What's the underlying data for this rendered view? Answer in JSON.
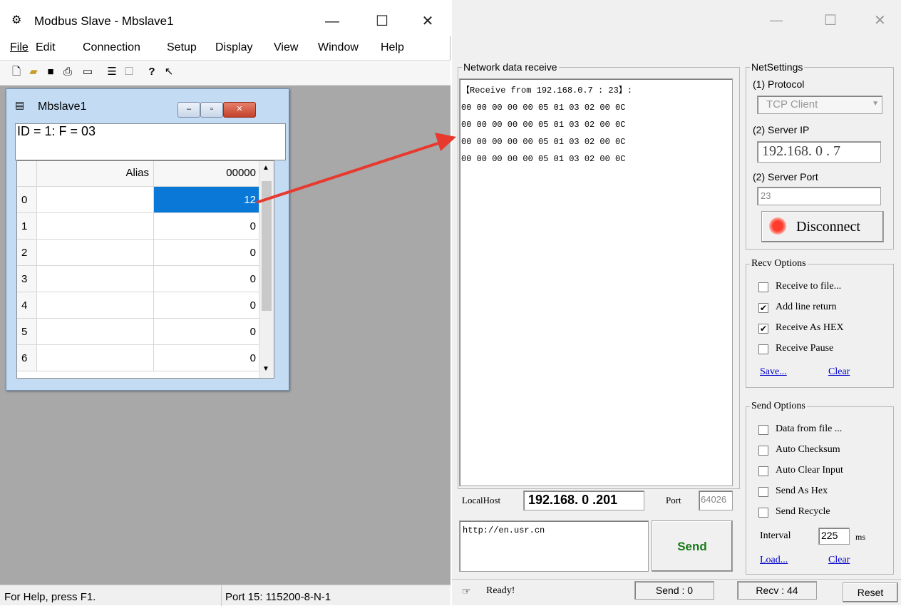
{
  "left": {
    "title": "Modbus Slave - Mbslave1",
    "menu": [
      "File",
      "Edit",
      "Connection",
      "Setup",
      "Display",
      "View",
      "Window",
      "Help"
    ],
    "child": {
      "title": "Mbslave1",
      "id_line": "ID = 1: F = 03",
      "col_alias": "Alias",
      "col_value": "00000",
      "rows": [
        {
          "idx": "0",
          "value": "12"
        },
        {
          "idx": "1",
          "value": "0"
        },
        {
          "idx": "2",
          "value": "0"
        },
        {
          "idx": "3",
          "value": "0"
        },
        {
          "idx": "4",
          "value": "0"
        },
        {
          "idx": "5",
          "value": "0"
        },
        {
          "idx": "6",
          "value": "0"
        }
      ]
    },
    "status_help": "For Help, press F1.",
    "status_port": "Port 15: 115200-8-N-1"
  },
  "right": {
    "receive_group": "Network data receive",
    "receive_lines": [
      "【Receive from 192.168.0.7 : 23】:",
      "00 00 00 00 00 05 01 03 02 00 0C",
      "00 00 00 00 00 05 01 03 02 00 0C",
      "00 00 00 00 00 05 01 03 02 00 0C",
      "00 00 00 00 00 05 01 03 02 00 0C"
    ],
    "net_settings": "NetSettings",
    "protocol_label": "(1) Protocol",
    "protocol_value": "TCP Client",
    "server_ip_label": "(2) Server IP",
    "server_ip_value": "192.168. 0 . 7",
    "server_port_label": "(2) Server Port",
    "server_port_value": "23",
    "disconnect": "Disconnect",
    "recv_options": "Recv Options",
    "recv_items": [
      {
        "label": "Receive to file...",
        "checked": false
      },
      {
        "label": "Add line return",
        "checked": true
      },
      {
        "label": "Receive As HEX",
        "checked": true
      },
      {
        "label": "Receive Pause",
        "checked": false
      }
    ],
    "recv_save": "Save...",
    "recv_clear": "Clear",
    "send_options": "Send Options",
    "send_items": [
      {
        "label": "Data from file ...",
        "checked": false
      },
      {
        "label": "Auto Checksum",
        "checked": false
      },
      {
        "label": "Auto Clear Input",
        "checked": false
      },
      {
        "label": "Send As Hex",
        "checked": false
      },
      {
        "label": "Send Recycle",
        "checked": false
      }
    ],
    "interval_label": "Interval",
    "interval_value": "225",
    "interval_unit": "ms",
    "send_load": "Load...",
    "send_clear": "Clear",
    "localhost_label": "LocalHost",
    "localhost_value": "192.168. 0 .201",
    "port_label": "Port",
    "port_value": "64026",
    "send_text": "http://en.usr.cn",
    "send_button": "Send",
    "status_ready": "Ready!",
    "status_send": "Send : 0",
    "status_recv": "Recv : 44",
    "reset": "Reset"
  },
  "colors": {
    "arrow": "#e8392f",
    "selected_cell": "#0a78d7",
    "send_button_text": "#1a7a1a"
  }
}
